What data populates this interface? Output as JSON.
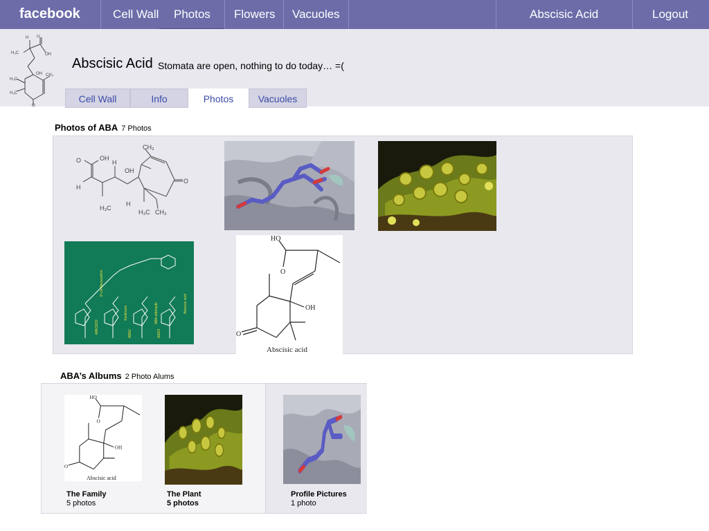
{
  "topbar": {
    "brand": "facebook",
    "nav": [
      "Cell Wall",
      "Photos",
      "Flowers",
      "Vacuoles"
    ],
    "profile_link": "Abscisic Acid",
    "logout": "Logout"
  },
  "profile": {
    "name": "Abscisic Acid",
    "status": "Stomata are open, nothing to do today… =("
  },
  "tabs": [
    "Cell Wall",
    "Info",
    "Photos",
    "Vacuoles"
  ],
  "active_tab": "Photos",
  "photos": {
    "title": "Photos of ABA",
    "count": "7 Photos",
    "structure_caption": "Abscisic acid",
    "pathway_labels": [
      "9'-cis-Neoxanthin",
      "Xanthoxin",
      "ABA-aldehyde",
      "Abscisic acid",
      "AtNCED3",
      "ABA2",
      "AAO3"
    ]
  },
  "albums": {
    "title": "ABA’s Albums",
    "count": "2 Photo Alums",
    "items": [
      {
        "title": "The Family",
        "count": "5 photos",
        "caption": "Abscisic acid"
      },
      {
        "title": "The   Plant",
        "count": "5 photos"
      },
      {
        "title": "Profile Pictures",
        "count": "1 photo"
      }
    ]
  },
  "colors": {
    "topbar": "#6d6ca9",
    "tab_link": "#3b4ba6",
    "profile_bg": "#e8e8ee",
    "pathway_bg": "#117a57"
  }
}
